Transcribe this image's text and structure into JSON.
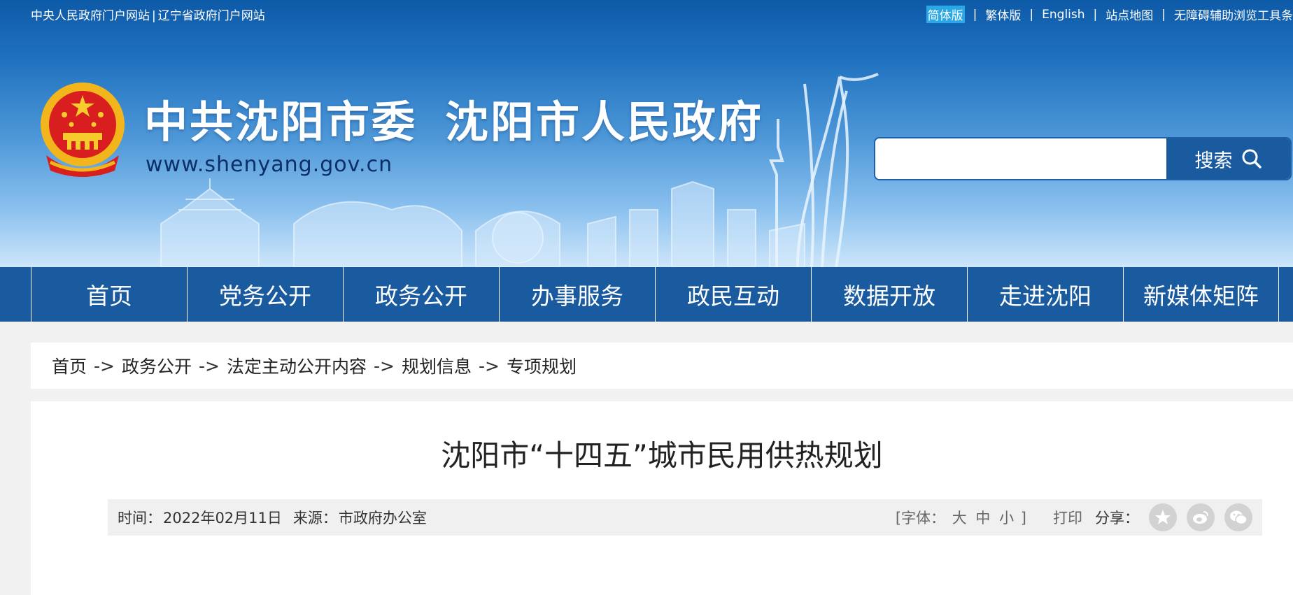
{
  "top_links_left": [
    "中央人民政府门户网站",
    "辽宁省政府门户网站"
  ],
  "top_links_left_sep": "|",
  "top_links_right": [
    "简体版",
    "繁体版",
    "English",
    "站点地图",
    "无障碍辅助浏览工具条"
  ],
  "top_links_right_sep": "|",
  "site_title_left": "中共沈阳市委",
  "site_title_right": "沈阳市人民政府",
  "site_url": "www.shenyang.gov.cn",
  "search": {
    "placeholder": "",
    "value": "",
    "button_label": "搜索"
  },
  "nav_items": [
    "首页",
    "党务公开",
    "政务公开",
    "办事服务",
    "政民互动",
    "数据开放",
    "走进沈阳",
    "新媒体矩阵"
  ],
  "breadcrumb": [
    "首页",
    "政务公开",
    "法定主动公开内容",
    "规划信息",
    "专项规划"
  ],
  "breadcrumb_separator": "->",
  "article": {
    "title": "沈阳市“十四五”城市民用供热规划",
    "time_label": "时间：",
    "time_value": "2022年02月11日",
    "source_label": "来源：",
    "source_value": "市政府办公室",
    "font_size_prefix": "[字体：",
    "font_sizes": [
      "大",
      "中",
      "小"
    ],
    "font_size_suffix": "]",
    "print_label": "打印",
    "share_label": "分享："
  },
  "share_icons": [
    "qzone-star-icon",
    "weibo-icon",
    "wechat-icon"
  ],
  "colors": {
    "nav_bg": "#1a5a9f",
    "header_top": "#0d5aa7",
    "active_lang_bg": "#2aa7e6",
    "page_bg": "#f1f1f1"
  }
}
